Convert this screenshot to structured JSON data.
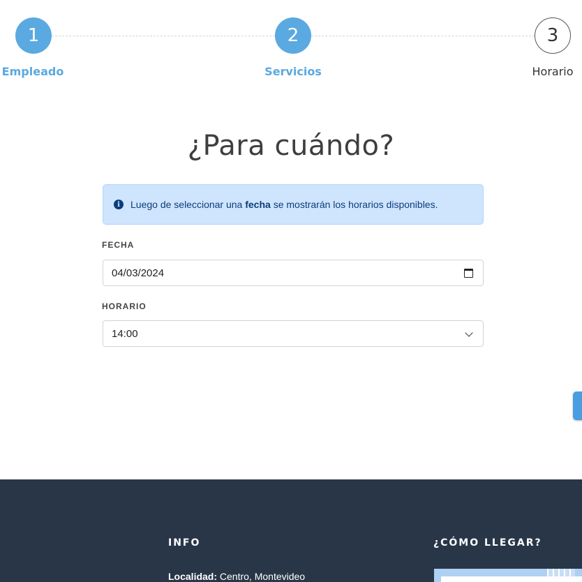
{
  "stepper": {
    "steps": [
      {
        "number": "1",
        "label": "Empleado",
        "state": "completed"
      },
      {
        "number": "2",
        "label": "Servicios",
        "state": "completed"
      },
      {
        "number": "3",
        "label": "Horario",
        "state": "current"
      }
    ]
  },
  "main": {
    "title": "¿Para cuándo?",
    "alert": {
      "text_before": "Luego de seleccionar una ",
      "bold": "fecha",
      "text_after": " se mostrarán los horarios disponibles."
    },
    "fecha": {
      "label": "FECHA",
      "value": "04/03/2024"
    },
    "horario": {
      "label": "HORARIO",
      "value": "14:00"
    }
  },
  "footer": {
    "info_heading": "INFO",
    "localidad_label": "Localidad:",
    "localidad_value": " Centro, Montevideo",
    "como_llegar_heading": "¿CÓMO LLEGAR?"
  },
  "colors": {
    "accent": "#5aa9e0",
    "alert_bg": "#cfe4fd",
    "footer_bg": "#283648"
  }
}
